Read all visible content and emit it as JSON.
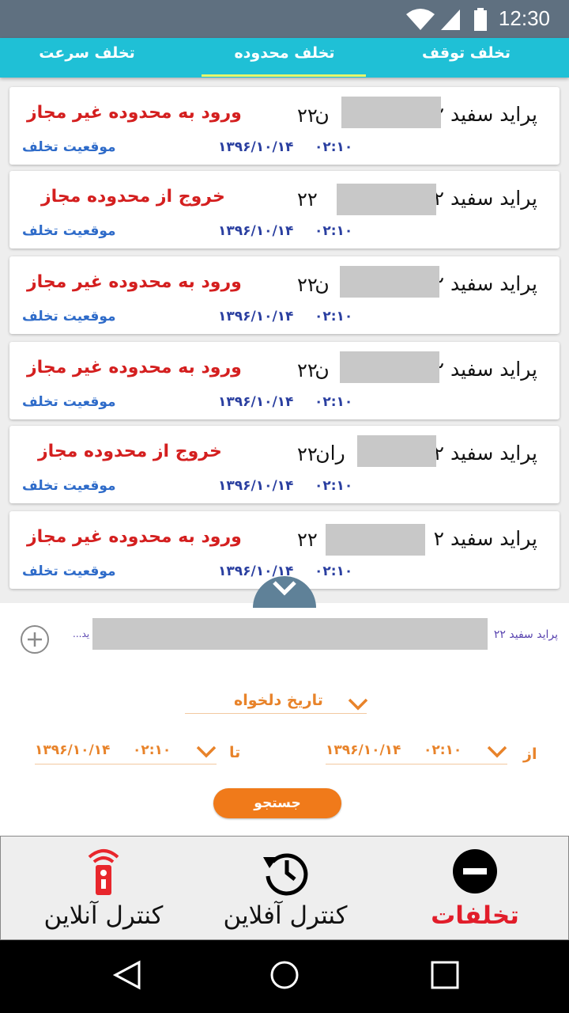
{
  "status_bar": {
    "time": "12:30",
    "icons": [
      "wifi-icon",
      "signal-icon",
      "battery-icon"
    ]
  },
  "tabs": [
    {
      "label": "تخلف توقف"
    },
    {
      "label": "تخلف محدوده",
      "active": true
    },
    {
      "label": "تخلف سرعت"
    }
  ],
  "violations": [
    {
      "vehicle": "پراید سفید ۲",
      "vehicle_tail": "ن",
      "plate_num": "۲۲",
      "event": "ورود به محدوده غیر مجاز",
      "date": "۱۳۹۶/۱۰/۱۴",
      "time": "۰۲:۱۰",
      "location_label": "موقعیت تخلف"
    },
    {
      "vehicle": "پراید سفید ۲",
      "vehicle_tail": "",
      "plate_num": "۲۲",
      "event": "خروج از محدوده مجاز",
      "date": "۱۳۹۶/۱۰/۱۴",
      "time": "۰۲:۱۰",
      "location_label": "موقعیت تخلف"
    },
    {
      "vehicle": "پراید سفید ۲",
      "vehicle_tail": "ن",
      "plate_num": "۲۲",
      "event": "ورود به محدوده غیر مجاز",
      "date": "۱۳۹۶/۱۰/۱۴",
      "time": "۰۲:۱۰",
      "location_label": "موقعیت تخلف"
    },
    {
      "vehicle": "پراید سفید ۲",
      "vehicle_tail": "ن",
      "plate_num": "۲۲",
      "event": "ورود به محدوده غیر مجاز",
      "date": "۱۳۹۶/۱۰/۱۴",
      "time": "۰۲:۱۰",
      "location_label": "موقعیت تخلف"
    },
    {
      "vehicle": "پراید سفید ۲",
      "vehicle_tail": "ران",
      "plate_num": "۲۲",
      "event": "خروج از محدوده مجاز",
      "date": "۱۳۹۶/۱۰/۱۴",
      "time": "۰۲:۱۰",
      "location_label": "موقعیت تخلف"
    },
    {
      "vehicle": "پراید سفید ۲",
      "vehicle_tail": "",
      "plate_num": "۲۲",
      "event": "ورود به محدوده غیر مجاز",
      "date": "۱۳۹۶/۱۰/۱۴",
      "time": "۰۲:۱۰",
      "location_label": "موقعیت تخلف"
    }
  ],
  "filter": {
    "selected_vehicle": "پراید سفید ۲۲",
    "ellipsis": "...ید",
    "range_label": "تاریخ دلخواه",
    "from_label": "از",
    "to_label": "تا",
    "from_date": "۱۳۹۶/۱۰/۱۴",
    "from_time": "۰۲:۱۰",
    "to_date": "۱۳۹۶/۱۰/۱۴",
    "to_time": "۰۲:۱۰",
    "search_label": "جستجو"
  },
  "bottom_nav": [
    {
      "label": "تخلفات",
      "icon": "minus-circle-icon",
      "active": true
    },
    {
      "label": "کنترل آفلاین",
      "icon": "history-icon"
    },
    {
      "label": "کنترل آنلاین",
      "icon": "remote-signal-icon"
    }
  ],
  "colors": {
    "accent": "#1fc0d6",
    "orange": "#f07a1a",
    "red": "#d41f1f"
  }
}
